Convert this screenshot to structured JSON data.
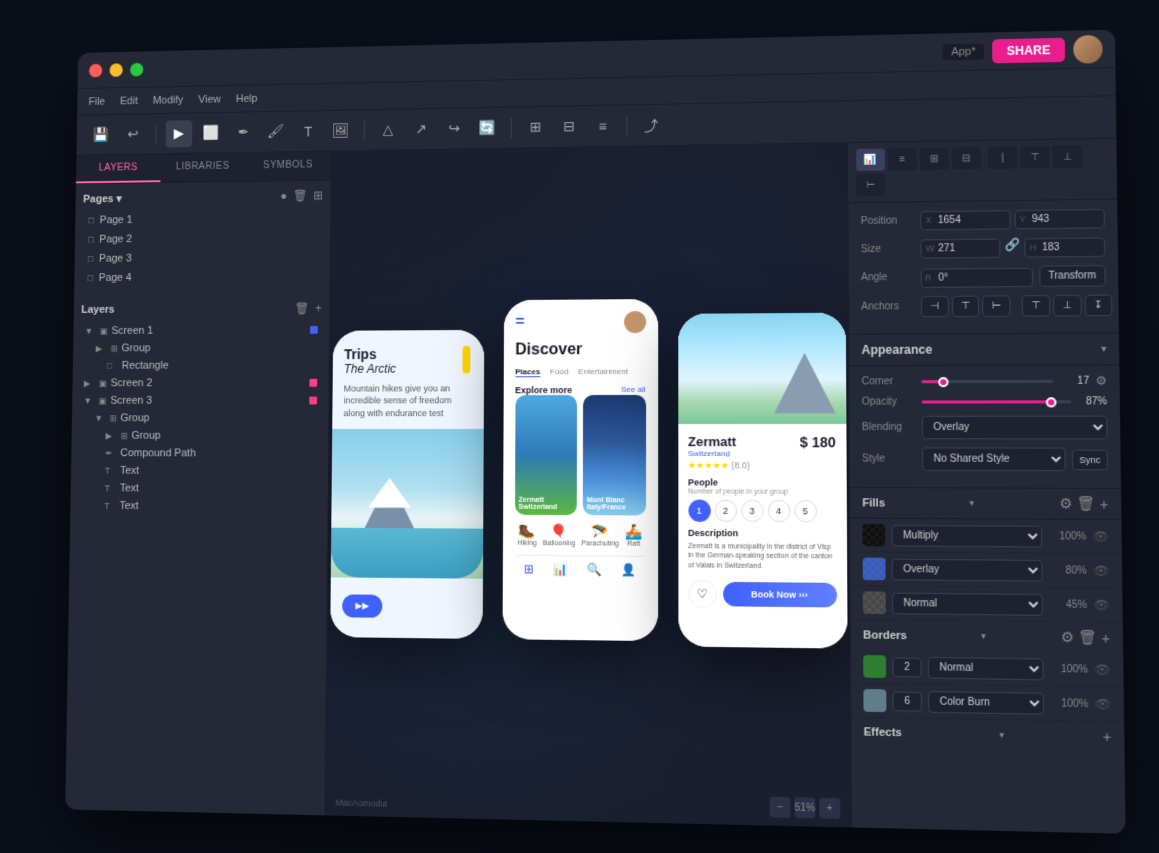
{
  "titleBar": {
    "appLabel": "App*",
    "shareLabel": "SHARE"
  },
  "menu": {
    "items": [
      "File",
      "Edit",
      "Modify",
      "View",
      "Help"
    ]
  },
  "leftPanel": {
    "tabs": [
      "LAYERS",
      "LIBRARIES",
      "SYMBOLS"
    ],
    "pages": {
      "title": "Pages",
      "items": [
        "Page 1",
        "Page 2",
        "Page 3",
        "Page 4"
      ]
    },
    "layers": {
      "title": "Layers",
      "items": [
        {
          "name": "Screen 1",
          "indent": 0,
          "type": "screen",
          "color": "#4060ff"
        },
        {
          "name": "Group",
          "indent": 1,
          "type": "group"
        },
        {
          "name": "Rectangle",
          "indent": 2,
          "type": "rect"
        },
        {
          "name": "Screen 2",
          "indent": 0,
          "type": "screen",
          "color": "#ff4080"
        },
        {
          "name": "Screen 3",
          "indent": 0,
          "type": "screen",
          "color": "#ff4080"
        },
        {
          "name": "Group",
          "indent": 1,
          "type": "group"
        },
        {
          "name": "Group",
          "indent": 2,
          "type": "group"
        },
        {
          "name": "Compound Path",
          "indent": 2,
          "type": "path"
        },
        {
          "name": "Text",
          "indent": 2,
          "type": "text"
        },
        {
          "name": "Text",
          "indent": 2,
          "type": "text"
        },
        {
          "name": "Text",
          "indent": 2,
          "type": "text"
        }
      ]
    }
  },
  "phones": {
    "phone1": {
      "title": "Trips",
      "subtitle": "The Arctic",
      "description": "Mountain hikes give you an incredible sense of freedom along with endurance test"
    },
    "phone2": {
      "title": "Discover",
      "tabs": [
        "Places",
        "Food",
        "Entertainment"
      ],
      "exploreMore": "Explore more",
      "seeAll": "See all",
      "activities": [
        "Hiking",
        "Ballooning",
        "Parachuting",
        "Raft"
      ],
      "cards": [
        {
          "label": "Zermatt Switzerland"
        },
        {
          "label": "Mont Blanc Italy/France"
        }
      ]
    },
    "phone3": {
      "placeName": "Zermatt",
      "location": "Switzerland",
      "price": "$ 180",
      "rating": "★★★★★",
      "ratingCount": "(8.0)",
      "peopleLabel": "People",
      "peopleSubLabel": "Number of people in your group",
      "people": [
        "1",
        "2",
        "3",
        "4",
        "5"
      ],
      "descriptionTitle": "Description",
      "description": "Zermatt is a municipality in the district of Visp in the German-speaking section of the canton of Valais in Switzerland.",
      "bookButton": "Book Now",
      "favoriteIcon": "♡"
    }
  },
  "rightPanel": {
    "position": {
      "label": "Position",
      "x": {
        "label": "X",
        "value": "1654"
      },
      "y": {
        "label": "Y",
        "value": "943"
      }
    },
    "size": {
      "label": "Size",
      "w": {
        "label": "W",
        "value": "271"
      },
      "h": {
        "label": "H",
        "value": "183"
      }
    },
    "angle": {
      "label": "Angle",
      "r": {
        "label": "R",
        "value": "0°"
      }
    },
    "transform": {
      "label": "Transform"
    },
    "anchors": {
      "label": "Anchors"
    },
    "appearance": {
      "title": "Appearance",
      "corner": {
        "label": "Corner",
        "value": "17",
        "sliderPercent": 17
      },
      "opacity": {
        "label": "Opacity",
        "value": "87%",
        "sliderPercent": 87
      },
      "blending": {
        "label": "Blending",
        "value": "Overlay"
      },
      "style": {
        "label": "Style",
        "value": "No Shared Style",
        "syncLabel": "Sync"
      }
    },
    "fills": {
      "title": "Fills",
      "items": [
        {
          "blendMode": "Multiply",
          "opacity": "100%",
          "visible": true
        },
        {
          "blendMode": "Overlay",
          "opacity": "80%",
          "visible": true
        },
        {
          "blendMode": "Normal",
          "opacity": "45%",
          "visible": true
        }
      ]
    },
    "borders": {
      "title": "Borders",
      "items": [
        {
          "size": "2",
          "type": "Normal",
          "opacity": "100%"
        },
        {
          "size": "6",
          "type": "Color Burn",
          "opacity": "100%"
        }
      ]
    },
    "effects": {
      "title": "Effects"
    },
    "sharedStyle": {
      "label": "Shared Style"
    },
    "normalLabels": [
      "Normal",
      "Normal"
    ]
  },
  "canvas": {
    "zoom": "51%",
    "fileName": "MacAomodia"
  }
}
